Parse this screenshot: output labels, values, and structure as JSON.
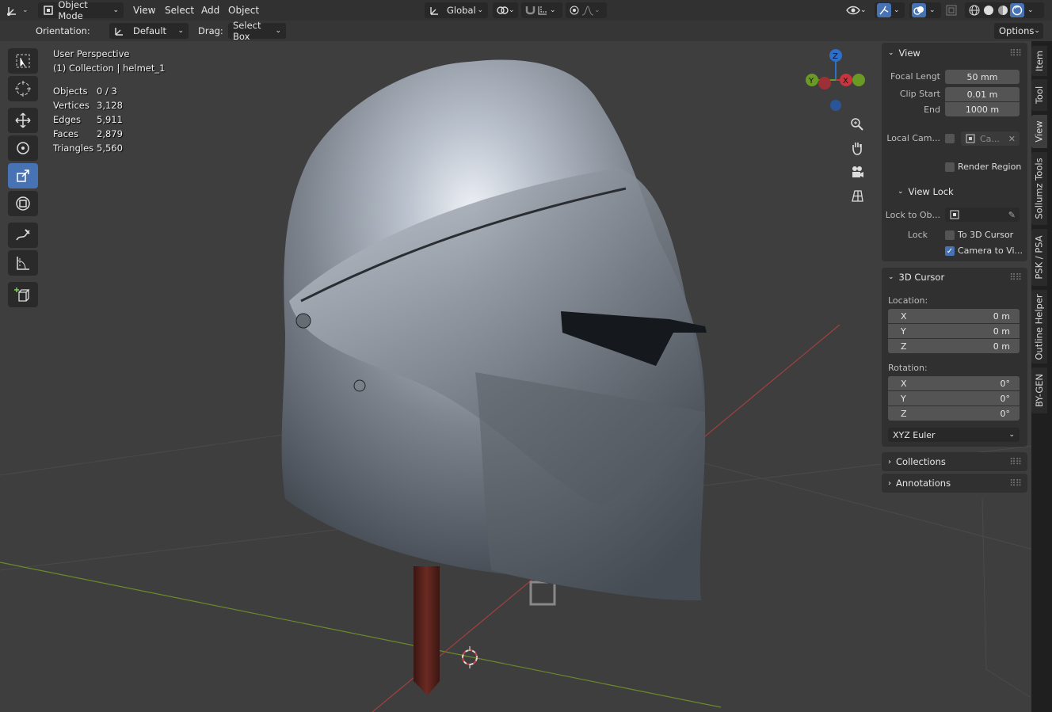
{
  "header": {
    "editor_type_icon": "axis-editor-icon",
    "mode": "Object Mode",
    "menus": [
      "View",
      "Select",
      "Add",
      "Object"
    ],
    "transform_orientation": "Global",
    "options_label": "Options"
  },
  "toolbar": {
    "orientation_label": "Orientation:",
    "orientation_value": "Default",
    "drag_label": "Drag:",
    "drag_value": "Select Box"
  },
  "tools": [
    {
      "name": "select-box-tool",
      "icon": "select-box-icon",
      "active": false
    },
    {
      "name": "cursor-tool",
      "icon": "cursor-icon",
      "active": false
    },
    {
      "name": "move-tool",
      "icon": "move-icon",
      "active": false
    },
    {
      "name": "rotate-tool",
      "icon": "rotate-icon",
      "active": false
    },
    {
      "name": "scale-tool",
      "icon": "scale-icon",
      "active": true
    },
    {
      "name": "transform-tool",
      "icon": "transform-icon",
      "active": false
    },
    {
      "name": "annotate-tool",
      "icon": "annotate-icon",
      "active": false
    },
    {
      "name": "measure-tool",
      "icon": "measure-icon",
      "active": false
    },
    {
      "name": "add-cube-tool",
      "icon": "add-cube-icon",
      "active": false
    }
  ],
  "overlay": {
    "view_name": "User Perspective",
    "collection": "(1) Collection | helmet_1",
    "stats": [
      {
        "label": "Objects",
        "value": "0 / 3"
      },
      {
        "label": "Vertices",
        "value": "3,128"
      },
      {
        "label": "Edges",
        "value": "5,911"
      },
      {
        "label": "Faces",
        "value": "2,879"
      },
      {
        "label": "Triangles",
        "value": "5,560"
      }
    ]
  },
  "gizmo": {
    "z": "Z",
    "y": "Y",
    "x": "X",
    "colors": {
      "x": "#c9353e",
      "y": "#6a9a23",
      "z": "#2e6fc9"
    }
  },
  "npanel": {
    "view": {
      "title": "View",
      "focal_label": "Focal Lengt",
      "focal_value": "50 mm",
      "clip_start_label": "Clip Start",
      "clip_start_value": "0.01 m",
      "end_label": "End",
      "end_value": "1000 m",
      "local_camera_label": "Local Cam...",
      "local_camera_value": "Ca...",
      "render_region_label": "Render Region",
      "render_region_checked": false
    },
    "view_lock": {
      "title": "View Lock",
      "lock_to_object_label": "Lock to Ob...",
      "lock_label": "Lock",
      "to_3d_cursor_label": "To 3D Cursor",
      "to_3d_cursor_checked": false,
      "camera_to_view_label": "Camera to Vi...",
      "camera_to_view_checked": true
    },
    "cursor": {
      "title": "3D Cursor",
      "location_label": "Location:",
      "loc_x_label": "X",
      "loc_x": "0 m",
      "loc_y_label": "Y",
      "loc_y": "0 m",
      "loc_z_label": "Z",
      "loc_z": "0 m",
      "rotation_label": "Rotation:",
      "rot_x_label": "X",
      "rot_x": "0°",
      "rot_y_label": "Y",
      "rot_y": "0°",
      "rot_z_label": "Z",
      "rot_z": "0°",
      "rotation_mode": "XYZ Euler"
    },
    "collections_title": "Collections",
    "annotations_title": "Annotations"
  },
  "side_tabs": [
    "Item",
    "Tool",
    "View",
    "Sollumz Tools",
    "PSK / PSA",
    "Outline Helper",
    "BY-GEN"
  ],
  "active_tab": "View"
}
